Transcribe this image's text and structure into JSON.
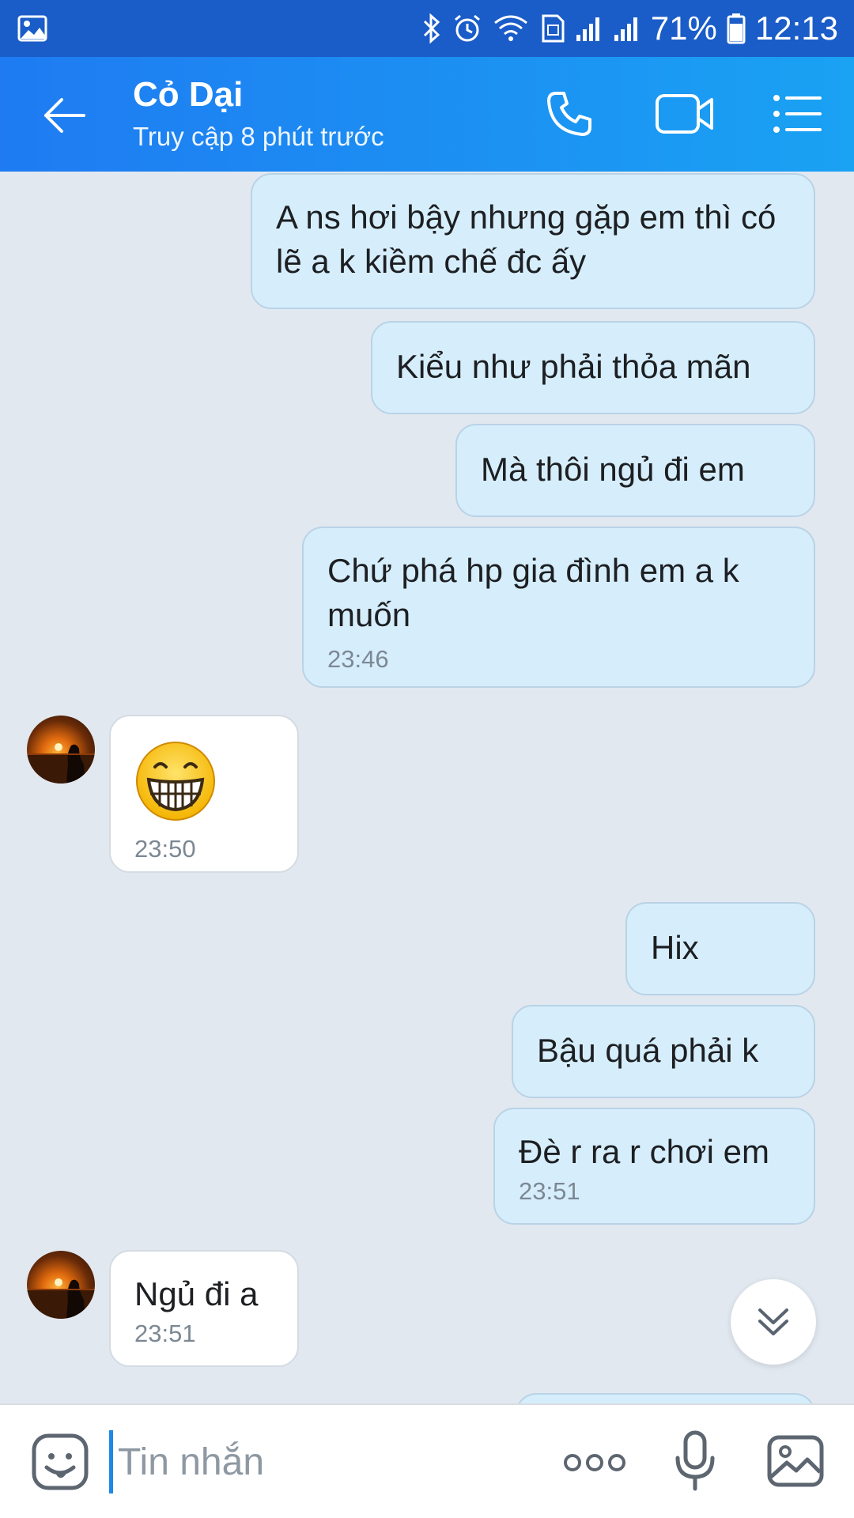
{
  "status_bar": {
    "battery": "71%",
    "time": "12:13"
  },
  "header": {
    "title": "Cỏ Dại",
    "subtitle": "Truy cập 8 phút trước"
  },
  "messages": [
    {
      "direction": "out",
      "text": "A ns hơi bậy nhưng gặp em thì có lẽ a k kiềm chế đc ấy",
      "time": ""
    },
    {
      "direction": "out",
      "text": "Kiểu như phải thỏa mãn",
      "time": ""
    },
    {
      "direction": "out",
      "text": "Mà thôi ngủ đi em",
      "time": ""
    },
    {
      "direction": "out",
      "text": "Chứ phá hp gia đình em a k muốn",
      "time": "23:46"
    },
    {
      "direction": "in",
      "text": "",
      "sticker": "grinning-face-emoji",
      "time": "23:50"
    },
    {
      "direction": "out",
      "text": "Hix",
      "time": ""
    },
    {
      "direction": "out",
      "text": "Bậu quá phải k",
      "time": ""
    },
    {
      "direction": "out",
      "text": "Đè r ra r chơi em",
      "time": "23:51"
    },
    {
      "direction": "in",
      "text": "Ngủ đi a",
      "time": "23:51"
    }
  ],
  "composer": {
    "placeholder": "Tin nhắn"
  },
  "colors": {
    "status_bar": "#1a5cc8",
    "header_start": "#1e7bf2",
    "header_end": "#1aa2f3",
    "outgoing_bubble": "#d6eefc",
    "incoming_bubble": "#ffffff",
    "chat_background": "#e2e8f0"
  }
}
